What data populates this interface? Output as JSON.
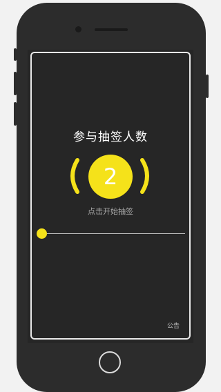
{
  "screen": {
    "title": "参与抽签人数",
    "participant_count": "2",
    "hint": "点击开始抽签",
    "notice_link": "公告"
  },
  "slider": {
    "value_fraction": 0.0
  },
  "colors": {
    "accent": "#f5e21a",
    "screen_bg": "#262626",
    "phone_body": "#2c2c2c",
    "frame": "#e9e9e9",
    "text_primary": "#ffffff",
    "text_secondary": "#a8a8a8"
  },
  "icons": {
    "left_bracket": "left-arc-icon",
    "right_bracket": "right-arc-icon"
  }
}
